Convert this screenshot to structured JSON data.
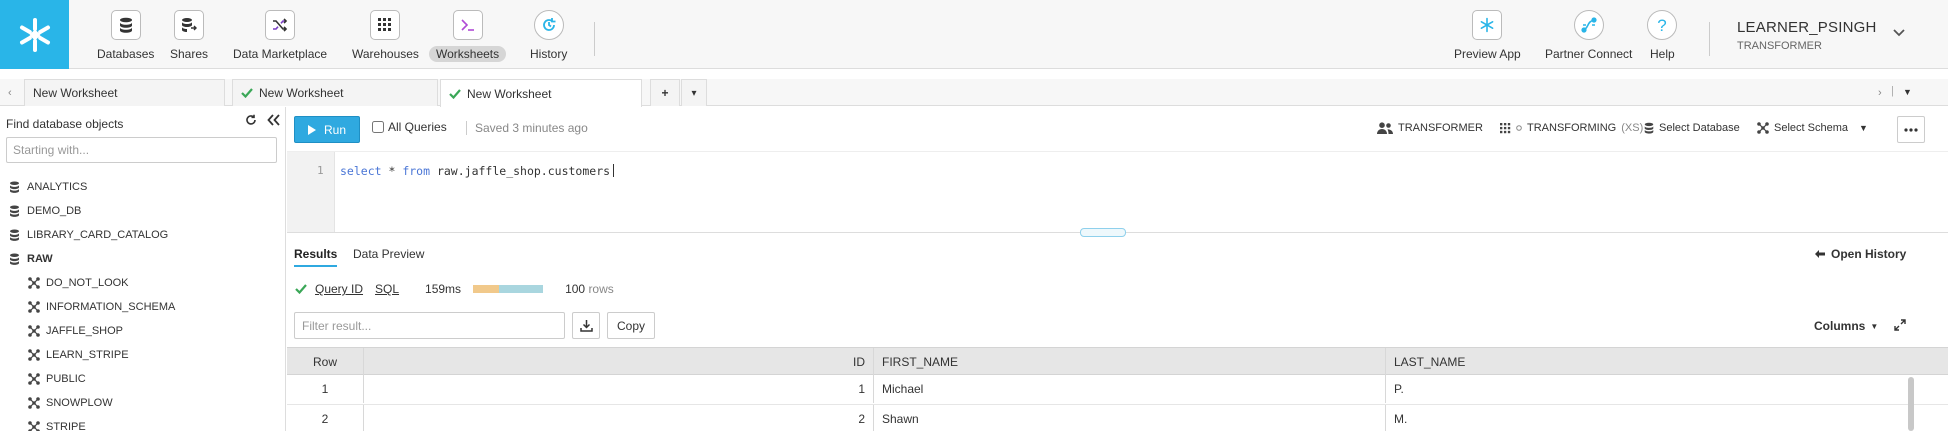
{
  "nav": {
    "items": [
      {
        "label": "Databases",
        "icon": "database-icon"
      },
      {
        "label": "Shares",
        "icon": "shares-icon"
      },
      {
        "label": "Data Marketplace",
        "icon": "shuffle-icon"
      },
      {
        "label": "Warehouses",
        "icon": "grid-icon"
      },
      {
        "label": "Worksheets",
        "icon": "terminal-icon"
      },
      {
        "label": "History",
        "icon": "history-icon"
      }
    ],
    "right_items": [
      {
        "label": "Preview App",
        "icon": "snowflake-icon"
      },
      {
        "label": "Partner Connect",
        "icon": "partner-connect-icon"
      },
      {
        "label": "Help",
        "icon": "help-icon"
      }
    ],
    "active": "Worksheets",
    "user": {
      "name": "LEARNER_PSINGH",
      "role": "TRANSFORMER"
    }
  },
  "tabs": [
    {
      "label": "New Worksheet",
      "saved": false
    },
    {
      "label": "New Worksheet",
      "saved": true
    },
    {
      "label": "New Worksheet",
      "saved": true
    }
  ],
  "tab_add_label": "+",
  "tab_menu_label": "▾",
  "sidebar": {
    "title": "Find database objects",
    "search_placeholder": "Starting with...",
    "databases": [
      "ANALYTICS",
      "DEMO_DB",
      "LIBRARY_CARD_CATALOG",
      "RAW"
    ],
    "schemas": [
      "DO_NOT_LOOK",
      "INFORMATION_SCHEMA",
      "JAFFLE_SHOP",
      "LEARN_STRIPE",
      "PUBLIC",
      "SNOWPLOW",
      "STRIPE"
    ]
  },
  "toolbar": {
    "run_label": "Run",
    "all_queries_label": "All Queries",
    "saved_text": "Saved 3 minutes ago",
    "role": "TRANSFORMER",
    "warehouse": "TRANSFORMING",
    "warehouse_size": "(XS)",
    "database": "Select Database",
    "schema": "Select Schema"
  },
  "editor": {
    "line": "1",
    "kw_select": "select",
    "star": " * ",
    "kw_from": "from",
    "table": " raw.jaffle_shop.customers"
  },
  "results": {
    "tab_results": "Results",
    "tab_preview": "Data Preview",
    "open_history": "Open History",
    "query_id_label": "Query ID",
    "sql_label": "SQL",
    "duration": "159ms",
    "timing_fraction": 0.37,
    "rows_number": "100",
    "rows_word": "rows",
    "filter_placeholder": "Filter result...",
    "copy_label": "Copy",
    "columns_label": "Columns",
    "headers": [
      "Row",
      "ID",
      "FIRST_NAME",
      "LAST_NAME"
    ],
    "rows": [
      {
        "row": "1",
        "id": "1",
        "first_name": "Michael",
        "last_name": "P."
      },
      {
        "row": "2",
        "id": "2",
        "first_name": "Shawn",
        "last_name": "M."
      }
    ]
  },
  "colors": {
    "brand": "#29b5e8",
    "run_button": "#2fa9e0",
    "success": "#3aa757"
  }
}
